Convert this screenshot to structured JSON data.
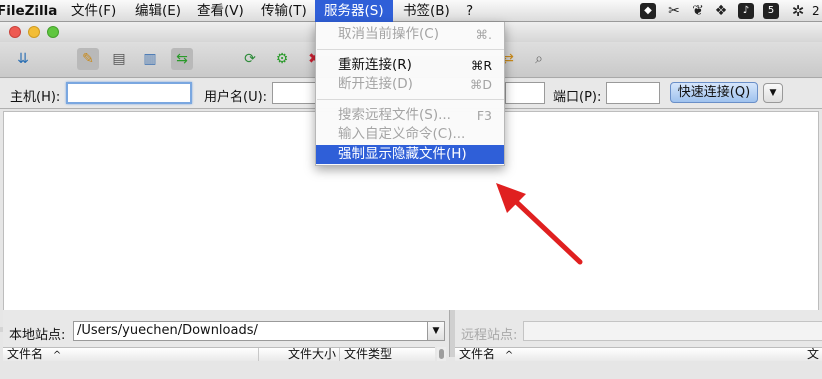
{
  "menubar": {
    "app_name": "FileZilla",
    "items": [
      "文件(F)",
      "编辑(E)",
      "查看(V)",
      "传输(T)",
      "服务器(S)",
      "书签(B)",
      "?"
    ],
    "active_item": "服务器(S)",
    "status_badge": "2",
    "status_icons": [
      "wolf-icon",
      "scissors-icon",
      "evernote-icon",
      "dropbox-icon",
      "sound-icon",
      "html5-icon",
      "gear-icon",
      "bug-icon"
    ]
  },
  "toolbar": {
    "icons": [
      "site-manager-icon",
      "message-log-icon",
      "local-tree-icon",
      "remote-tree-icon",
      "transfer-queue-icon",
      "refresh-icon",
      "process-queue-icon",
      "cancel-icon",
      "filter-icon",
      "compare-icon",
      "sync-browse-icon",
      "search-icon"
    ]
  },
  "quickconnect": {
    "host_label": "主机(H):",
    "host_value": "",
    "user_label": "用户名(U):",
    "user_value": "",
    "port_label": "端口(P):",
    "port_value": "",
    "connect_label": "快速连接(Q)",
    "dropdown_glyph": "▼"
  },
  "server_menu": {
    "items": [
      {
        "label": "取消当前操作(C)",
        "shortcut": "⌘.",
        "enabled": false
      },
      {
        "label": "重新连接(R)",
        "shortcut": "⌘R",
        "enabled": true
      },
      {
        "label": "断开连接(D)",
        "shortcut": "⌘D",
        "enabled": false
      },
      {
        "label": "搜索远程文件(S)...",
        "shortcut": "F3",
        "enabled": false
      },
      {
        "label": "输入自定义命令(C)...",
        "shortcut": "",
        "enabled": false
      },
      {
        "label": "强制显示隐藏文件(H)",
        "shortcut": "",
        "enabled": true,
        "highlighted": true
      }
    ]
  },
  "local_pane": {
    "site_label": "本地站点:",
    "path": "/Users/yuechen/Downloads/",
    "columns": [
      "文件名",
      "文件大小",
      "文件类型"
    ],
    "sort_glyph": "^"
  },
  "remote_pane": {
    "site_label": "远程站点:",
    "path": "",
    "columns": [
      "文件名",
      "文"
    ],
    "sort_glyph": "^"
  },
  "colors": {
    "highlight": "#2f5fd8",
    "arrow": "#e02020",
    "button_blue": "#9fc2ee"
  }
}
